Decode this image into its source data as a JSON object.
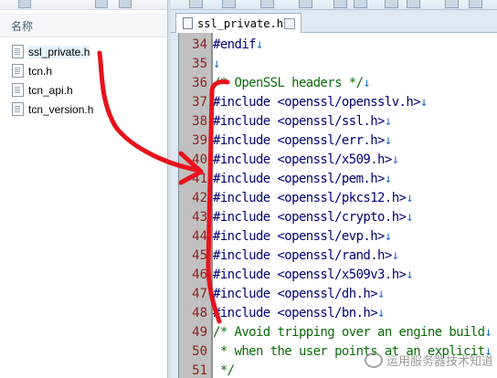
{
  "explorer": {
    "column_header": "名称",
    "files": [
      {
        "name": "ssl_private.h",
        "selected": true
      },
      {
        "name": "tcn.h",
        "selected": false
      },
      {
        "name": "tcn_api.h",
        "selected": false
      },
      {
        "name": "tcn_version.h",
        "selected": false
      }
    ]
  },
  "editor": {
    "tab_title": "ssl_private.h",
    "lines": [
      {
        "num": "34",
        "text": "#endif",
        "kind": "directive"
      },
      {
        "num": "35",
        "text": "",
        "kind": "blank"
      },
      {
        "num": "36",
        "text": "/* OpenSSL headers */",
        "kind": "comment"
      },
      {
        "num": "37",
        "text": "#include <openssl/opensslv.h>",
        "kind": "directive"
      },
      {
        "num": "38",
        "text": "#include <openssl/ssl.h>",
        "kind": "directive"
      },
      {
        "num": "39",
        "text": "#include <openssl/err.h>",
        "kind": "directive"
      },
      {
        "num": "40",
        "text": "#include <openssl/x509.h>",
        "kind": "directive"
      },
      {
        "num": "41",
        "text": "#include <openssl/pem.h>",
        "kind": "directive"
      },
      {
        "num": "42",
        "text": "#include <openssl/pkcs12.h>",
        "kind": "directive"
      },
      {
        "num": "43",
        "text": "#include <openssl/crypto.h>",
        "kind": "directive"
      },
      {
        "num": "44",
        "text": "#include <openssl/evp.h>",
        "kind": "directive"
      },
      {
        "num": "45",
        "text": "#include <openssl/rand.h>",
        "kind": "directive"
      },
      {
        "num": "46",
        "text": "#include <openssl/x509v3.h>",
        "kind": "directive"
      },
      {
        "num": "47",
        "text": "#include <openssl/dh.h>",
        "kind": "directive"
      },
      {
        "num": "48",
        "text": "#include <openssl/bn.h>",
        "kind": "directive"
      },
      {
        "num": "49",
        "text": "/* Avoid tripping over an engine build",
        "kind": "comment"
      },
      {
        "num": "50",
        "text": " * when the user points at an explicit",
        "kind": "comment"
      },
      {
        "num": "51",
        "text": " */",
        "kind": "comment"
      }
    ],
    "eol_marker": "↓"
  },
  "annotation": {
    "stroke_color": "#e8121b"
  },
  "watermark": {
    "text": "运用服务器技术知道"
  }
}
